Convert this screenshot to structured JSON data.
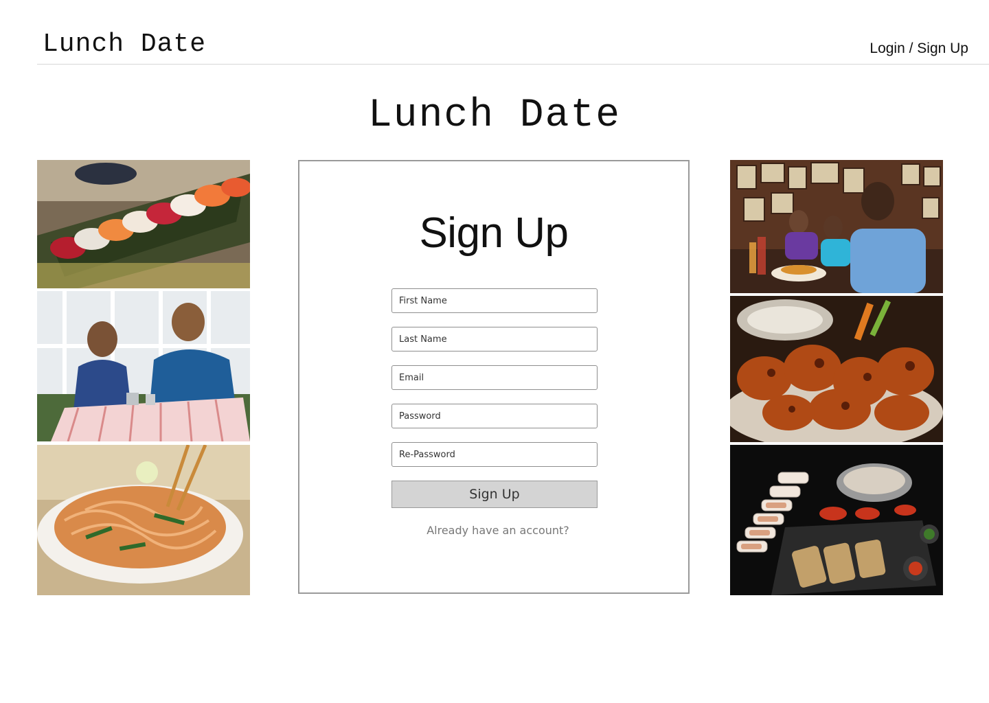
{
  "header": {
    "brand": "Lunch Date",
    "auth_link": "Login / Sign Up"
  },
  "hero": {
    "title": "Lunch Date"
  },
  "signup": {
    "title": "Sign Up",
    "fields": [
      {
        "placeholder": "First Name",
        "value": ""
      },
      {
        "placeholder": "Last Name",
        "value": ""
      },
      {
        "placeholder": "Email",
        "value": ""
      },
      {
        "placeholder": "Password",
        "value": ""
      },
      {
        "placeholder": "Re-Password",
        "value": ""
      }
    ],
    "submit_label": "Sign Up",
    "signin_link": "Already have an account?"
  },
  "gallery": {
    "left": [
      "sushi-photo",
      "couple-cafe-photo",
      "pad-thai-photo"
    ],
    "right": [
      "friends-diner-photo",
      "chicken-wings-photo",
      "korean-bbq-photo"
    ]
  },
  "colors": {
    "border": "#9a9a9a",
    "button_bg": "#d4d4d4",
    "muted_text": "#777777"
  }
}
